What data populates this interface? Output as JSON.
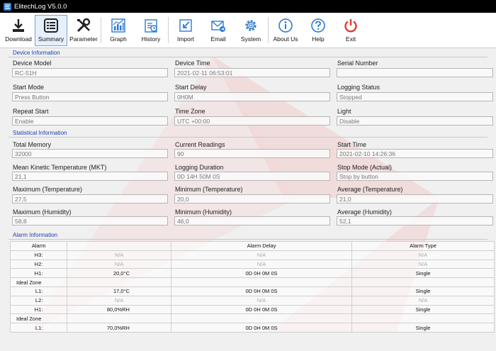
{
  "window": {
    "title": "ElitechLog V5.0.0"
  },
  "toolbar": {
    "buttons": [
      {
        "label": "Download",
        "icon": "download-icon"
      },
      {
        "label": "Summary",
        "icon": "summary-icon"
      },
      {
        "label": "Parameter",
        "icon": "tools-icon"
      },
      {
        "label": "Graph",
        "icon": "graph-icon"
      },
      {
        "label": "History",
        "icon": "history-icon"
      },
      {
        "label": "Import",
        "icon": "import-icon"
      },
      {
        "label": "Email",
        "icon": "email-icon"
      },
      {
        "label": "System",
        "icon": "gear-icon"
      },
      {
        "label": "About Us",
        "icon": "info-icon"
      },
      {
        "label": "Help",
        "icon": "help-icon"
      },
      {
        "label": "Exit",
        "icon": "power-icon"
      }
    ],
    "active": "Summary"
  },
  "device_info": {
    "title": "Device Information",
    "device_model": {
      "label": "Device Model",
      "value": "RC-51H"
    },
    "device_time": {
      "label": "Device Time",
      "value": "2021-02-11 06:53:01"
    },
    "serial_number": {
      "label": "Serial Number",
      "value": ""
    },
    "start_mode": {
      "label": "Start Mode",
      "value": "Press Button"
    },
    "start_delay": {
      "label": "Start Delay",
      "value": "0H0M"
    },
    "logging_status": {
      "label": "Logging Status",
      "value": "Stopped"
    },
    "repeat_start": {
      "label": "Repeat Start",
      "value": "Enable"
    },
    "time_zone": {
      "label": "Time Zone",
      "value": "UTC +00:00"
    },
    "light": {
      "label": "Light",
      "value": "Disable"
    }
  },
  "stats": {
    "title": "Statistical Information",
    "total_memory": {
      "label": "Total Memory",
      "value": "32000"
    },
    "current_readings": {
      "label": "Current Readings",
      "value": "90"
    },
    "start_time": {
      "label": "Start Time",
      "value": "2021-02-10 14:26:36"
    },
    "mkt": {
      "label": "Mean Kinetic Temperature (MKT)",
      "value": "21,1"
    },
    "logging_duration": {
      "label": "Logging Duration",
      "value": "0D 14H 50M 0S"
    },
    "stop_mode": {
      "label": "Stop Mode (Actual)",
      "value": "Stop by button"
    },
    "max_temp": {
      "label": "Maximum (Temperature)",
      "value": "27,5"
    },
    "min_temp": {
      "label": "Minimum (Temperature)",
      "value": "20,0"
    },
    "avg_temp": {
      "label": "Average (Temperature)",
      "value": "21,0"
    },
    "max_hum": {
      "label": "Maximum (Humidity)",
      "value": "58,8"
    },
    "min_hum": {
      "label": "Minimum (Humidity)",
      "value": "46,0"
    },
    "avg_hum": {
      "label": "Average (Humidity)",
      "value": "52,1"
    }
  },
  "alarm": {
    "title": "Alarm Information",
    "headers": {
      "alarm": "Alarm",
      "delay": "Alarm Delay",
      "type": "Alarm Type"
    },
    "rows": [
      {
        "kind": "row",
        "label": "H3:",
        "value": "N/A",
        "delay": "N/A",
        "type": "N/A",
        "na": true
      },
      {
        "kind": "row",
        "label": "H2:",
        "value": "N/A",
        "delay": "N/A",
        "type": "N/A",
        "na": true
      },
      {
        "kind": "row",
        "label": "H1:",
        "value": "20,0°C",
        "delay": "0D 0H 0M 0S",
        "type": "Single",
        "na": false
      },
      {
        "kind": "zone",
        "label": "Ideal Zone"
      },
      {
        "kind": "row",
        "label": "L1:",
        "value": "17,0°C",
        "delay": "0D 0H 0M 0S",
        "type": "Single",
        "na": false
      },
      {
        "kind": "row",
        "label": "L2:",
        "value": "N/A",
        "delay": "N/A",
        "type": "N/A",
        "na": true
      },
      {
        "kind": "row",
        "label": "H1:",
        "value": "80,0%RH",
        "delay": "0D 0H 0M 0S",
        "type": "Single",
        "na": false
      },
      {
        "kind": "zone",
        "label": "Ideal Zone"
      },
      {
        "kind": "row",
        "label": "L1:",
        "value": "70,0%RH",
        "delay": "0D 0H 0M 0S",
        "type": "Single",
        "na": false
      }
    ]
  },
  "colors": {
    "section_title": "#1a3fb3",
    "watermark": "#e8b4b4",
    "exit_red": "#e03a2e",
    "icon_blue": "#2b7bd6"
  }
}
